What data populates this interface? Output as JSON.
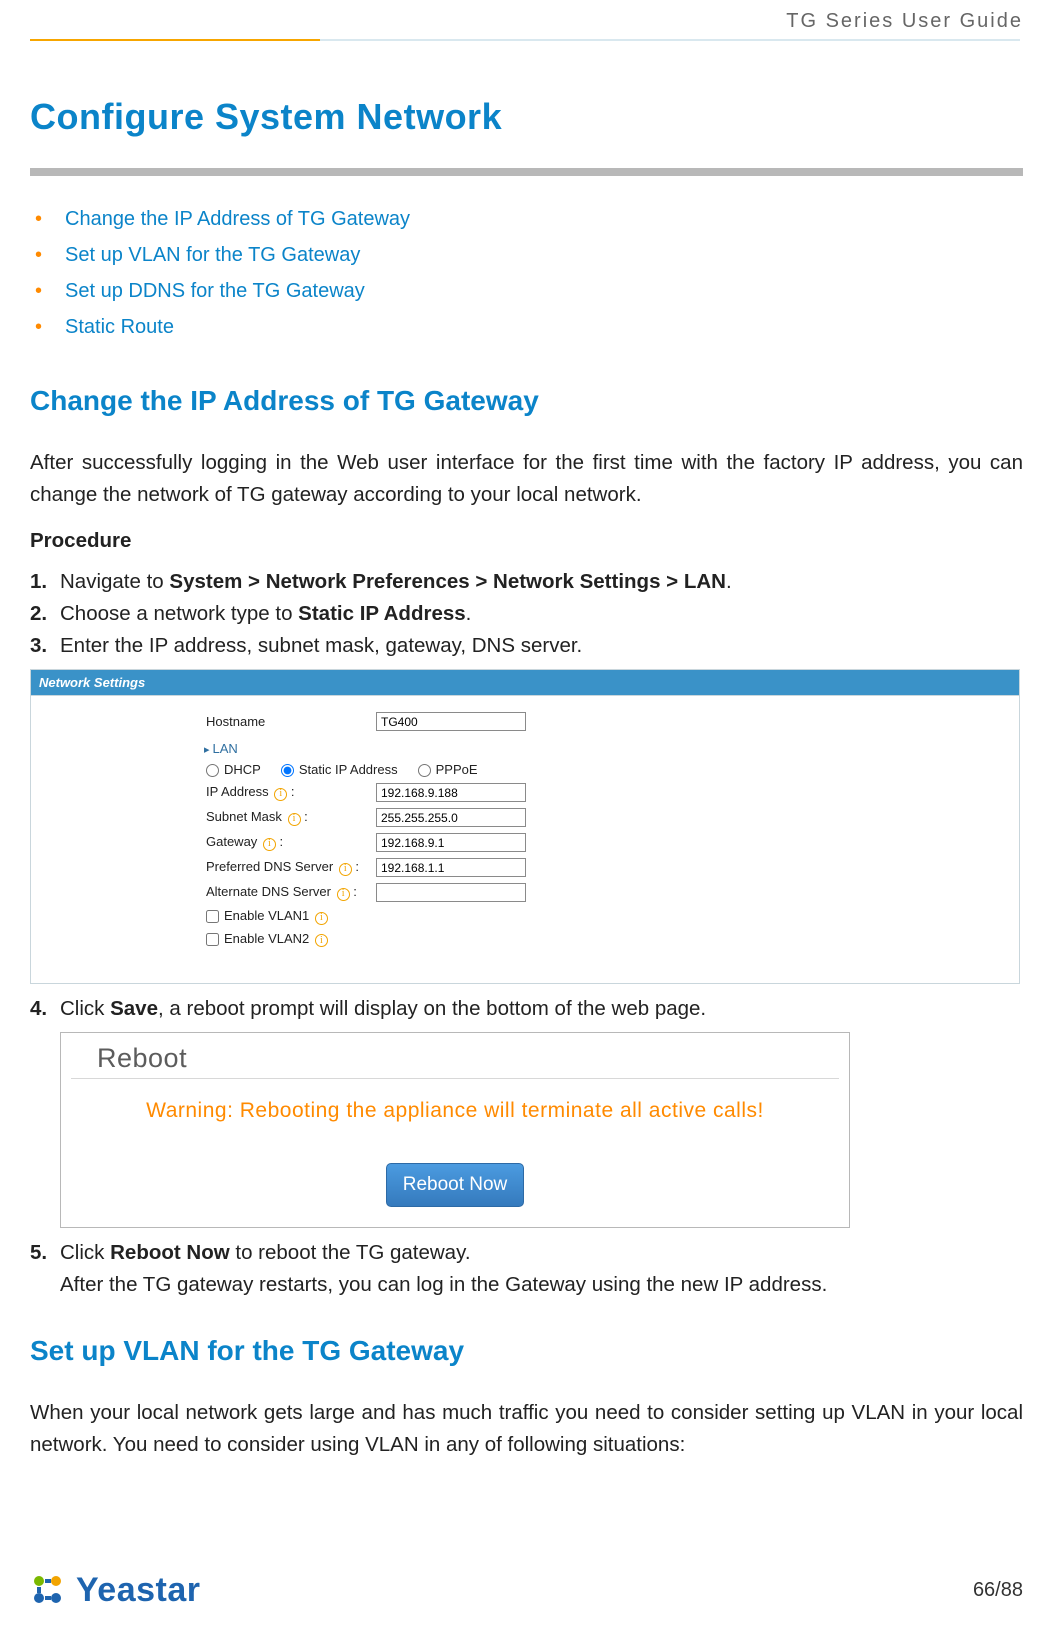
{
  "header": {
    "title": "TG  Series  User  Guide"
  },
  "h1": "Configure System Network",
  "toc": {
    "items": [
      "Change the IP Address of TG Gateway",
      "Set up VLAN for the TG Gateway",
      "Set up DDNS for the TG Gateway",
      "Static Route"
    ]
  },
  "section1": {
    "title": "Change the IP Address of TG Gateway",
    "intro": "After successfully logging in the Web user interface for the first time with the factory IP address, you can change the network of TG gateway according to your local network.",
    "procedure_label": "Procedure",
    "steps": {
      "s1_a": "Navigate to ",
      "s1_b": "System > Network Preferences > Network Settings > LAN",
      "s1_c": ".",
      "s2_a": "Choose a network type to ",
      "s2_b": "Static IP Address",
      "s2_c": ".",
      "s3": "Enter the IP address, subnet mask, gateway, DNS server.",
      "s4_a": "Click ",
      "s4_b": "Save",
      "s4_c": ", a reboot prompt will display on the bottom of the web page.",
      "s5_a": "Click ",
      "s5_b": "Reboot Now",
      "s5_c": " to reboot the TG gateway.",
      "s5_sub": "After the TG gateway restarts, you can log in the Gateway using the new IP address."
    }
  },
  "net_panel": {
    "title": "Network Settings",
    "hostname_label": "Hostname",
    "hostname_value": "TG400",
    "lan_label": "LAN",
    "radio": {
      "dhcp": "DHCP",
      "static": "Static IP Address",
      "pppoe": "PPPoE"
    },
    "ip_label": "IP Address",
    "ip_value": "192.168.9.188",
    "mask_label": "Subnet Mask",
    "mask_value": "255.255.255.0",
    "gw_label": "Gateway",
    "gw_value": "192.168.9.1",
    "pdns_label": "Preferred DNS Server",
    "pdns_value": "192.168.1.1",
    "adns_label": "Alternate DNS Server",
    "adns_value": "",
    "vlan1_label": "Enable VLAN1",
    "vlan2_label": "Enable VLAN2"
  },
  "reboot_panel": {
    "heading": "Reboot",
    "warning": "Warning: Rebooting the appliance will terminate all active calls!",
    "button": "Reboot Now"
  },
  "section2": {
    "title": "Set up VLAN for the TG Gateway",
    "intro": "When your local network gets large and has much traffic you need to consider setting up VLAN in your local network. You need to consider using VLAN in any of following situations:"
  },
  "footer": {
    "brand": "Yeastar",
    "page": "66/88"
  }
}
